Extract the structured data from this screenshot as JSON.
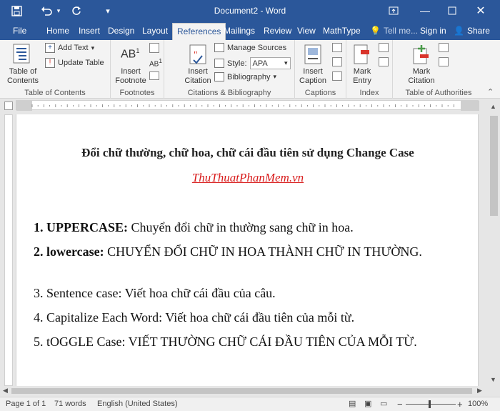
{
  "app": {
    "title": "Document2 - Word",
    "tell_me": "Tell me...",
    "sign_in": "Sign in",
    "share": "Share"
  },
  "tabs": [
    "File",
    "Home",
    "Insert",
    "Design",
    "Layout",
    "References",
    "Mailings",
    "Review",
    "View",
    "MathType"
  ],
  "active_tab": "References",
  "ribbon": {
    "toc": {
      "btn": "Table of Contents",
      "add_text": "Add Text",
      "update_table": "Update Table",
      "group": "Table of Contents"
    },
    "footnotes": {
      "btn": "Insert Footnote",
      "group": "Footnotes"
    },
    "citations": {
      "btn": "Insert Citation",
      "manage_sources": "Manage Sources",
      "style_label": "Style:",
      "style_value": "APA",
      "bibliography": "Bibliography",
      "group": "Citations & Bibliography"
    },
    "captions": {
      "btn": "Insert Caption",
      "group": "Captions"
    },
    "index": {
      "btn": "Mark Entry",
      "group": "Index"
    },
    "authorities": {
      "btn": "Mark Citation",
      "group": "Table of Authorities"
    }
  },
  "document": {
    "heading": "Đổi chữ thường, chữ hoa, chữ cái đầu tiên sử dụng Change Case",
    "link": "ThuThuatPhanMem.vn",
    "items": [
      {
        "label": "1. UPPERCASE:",
        "text": " Chuyển đổi chữ in thường sang chữ in hoa.",
        "bold": true
      },
      {
        "label": "2. lowercase:",
        "text": " CHUYỂN ĐỔI CHỮ IN HOA THÀNH CHỮ IN THƯỜNG.",
        "bold": true
      },
      {
        "label": "",
        "text": "3. Sentence case: Viết hoa chữ cái đầu của câu.",
        "bold": false
      },
      {
        "label": "",
        "text": "4. Capitalize Each Word: Viết hoa chữ cái đầu tiên của mỗi từ.",
        "bold": false
      },
      {
        "label": "",
        "text": "5. tOGGLE Case: VIẾT THƯỜNG CHỮ CÁI ĐẦU TIÊN CỦA MỖI TỪ.",
        "bold": false
      }
    ]
  },
  "status": {
    "page": "Page 1 of 1",
    "words": "71 words",
    "language": "English (United States)",
    "zoom": "100%"
  }
}
